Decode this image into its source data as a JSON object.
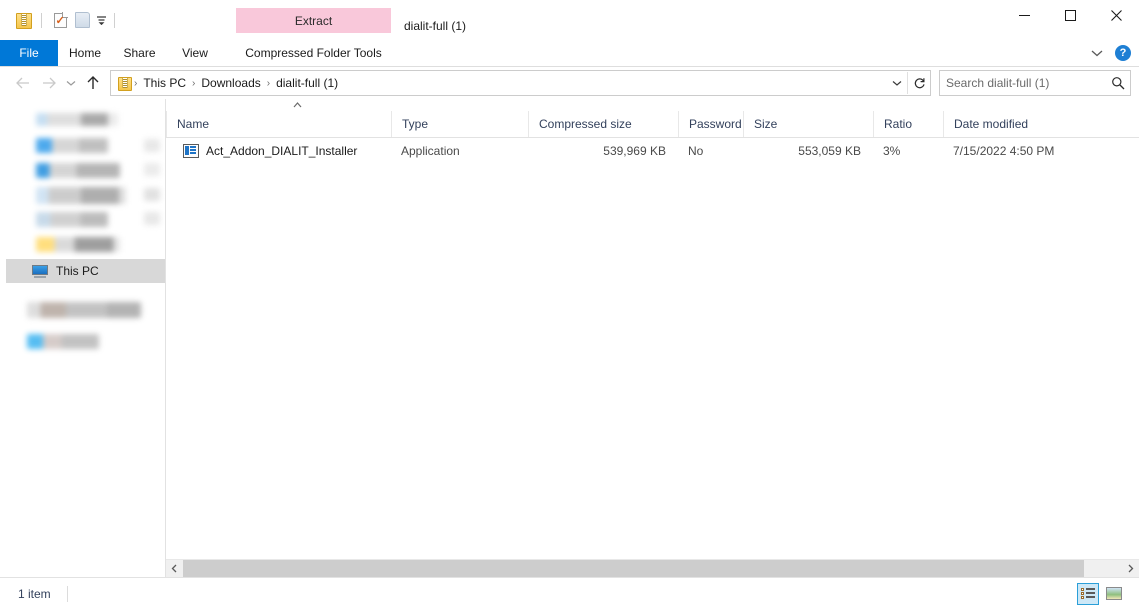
{
  "window": {
    "title": "dialit-full (1)",
    "controls": {
      "minimize": "minimize-button",
      "maximize": "maximize-button",
      "close": "close-button"
    }
  },
  "quick_access": {
    "items": [
      {
        "icon": "zip-folder-icon",
        "name": "zip-folder"
      },
      {
        "icon": "properties-icon",
        "name": "properties"
      },
      {
        "icon": "new-folder-icon",
        "name": "new-folder"
      }
    ],
    "customize_label": "▾"
  },
  "ribbon": {
    "tabs": [
      {
        "label": "File",
        "active": true
      },
      {
        "label": "Home",
        "active": false
      },
      {
        "label": "Share",
        "active": false
      },
      {
        "label": "View",
        "active": false
      }
    ],
    "contextual": {
      "group_label": "Extract",
      "tools_label": "Compressed Folder Tools",
      "accent_color": "#f9c8da"
    },
    "expand_label": "⌄",
    "help_label": "?"
  },
  "address_bar": {
    "back_label": "←",
    "forward_label": "→",
    "recent_label": "⌄",
    "up_label": "↑",
    "breadcrumbs": [
      {
        "label": "This PC"
      },
      {
        "label": "Downloads"
      },
      {
        "label": "dialit-full (1)"
      }
    ],
    "separator": "›",
    "dropdown_label": "⌄",
    "refresh_label": "↻"
  },
  "search": {
    "placeholder": "Search dialit-full (1)",
    "value": "",
    "icon": "search-icon"
  },
  "sidebar": {
    "this_pc_label": "This PC",
    "this_pc_selected": true
  },
  "columns": [
    {
      "key": "name",
      "label": "Name",
      "align": "left",
      "sorted": "asc"
    },
    {
      "key": "type",
      "label": "Type",
      "align": "left"
    },
    {
      "key": "compressed_size",
      "label": "Compressed size",
      "align": "right"
    },
    {
      "key": "password",
      "label": "Password ...",
      "align": "left"
    },
    {
      "key": "size",
      "label": "Size",
      "align": "right"
    },
    {
      "key": "ratio",
      "label": "Ratio",
      "align": "left"
    },
    {
      "key": "date_modified",
      "label": "Date modified",
      "align": "left"
    }
  ],
  "files": [
    {
      "name": "Act_Addon_DIALIT_Installer",
      "icon": "application-icon",
      "type": "Application",
      "compressed_size": "539,969 KB",
      "password": "No",
      "size": "553,059 KB",
      "ratio": "3%",
      "date_modified": "7/15/2022 4:50 PM"
    }
  ],
  "scrollbar": {
    "left_label": "‹",
    "right_label": "›"
  },
  "status_bar": {
    "item_count": "1 item",
    "views": [
      {
        "name": "details-view",
        "active": true
      },
      {
        "name": "large-icons-view",
        "active": false
      }
    ]
  },
  "colors": {
    "accent": "#0078d7",
    "contextual_tab": "#f9c8da",
    "selection": "#d8d8d8",
    "header_text": "#33415c"
  }
}
